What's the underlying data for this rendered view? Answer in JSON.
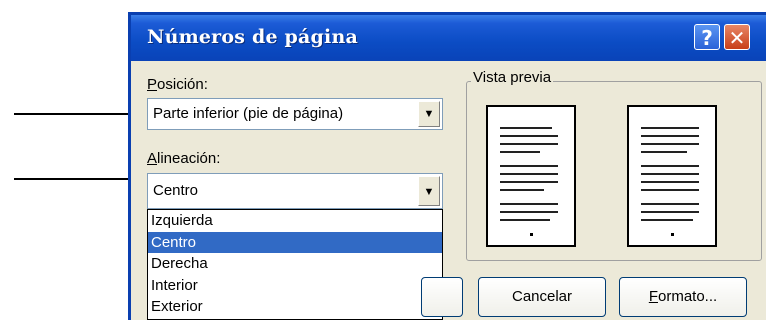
{
  "dialog": {
    "title": "Números de página",
    "help_icon": "?",
    "close_icon": "✕",
    "position_label": "Posición:",
    "position_value": "Parte inferior (pie de página)",
    "alignment_label": "Alineación:",
    "alignment_value": "Centro",
    "alignment_options": [
      "Izquierda",
      "Centro",
      "Derecha",
      "Interior",
      "Exterior"
    ],
    "alignment_selected": "Centro",
    "preview_label": "Vista previa",
    "buttons": {
      "cancel": "Cancelar",
      "format": "Formato..."
    }
  },
  "colors": {
    "titlebar": "#0b4cc4",
    "dialog_bg": "#ece9d8",
    "selection": "#316ac5",
    "close_button": "#c83e18"
  },
  "icons": [
    "help-icon",
    "close-icon",
    "dropdown-arrow-icon",
    "annotation-arrow"
  ]
}
